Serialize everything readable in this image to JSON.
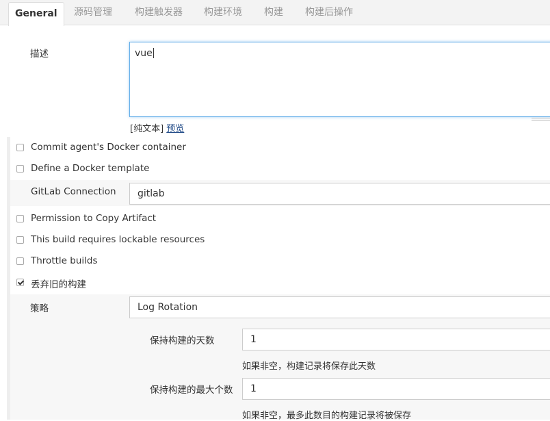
{
  "tabs": [
    {
      "label": "General",
      "active": true
    },
    {
      "label": "源码管理"
    },
    {
      "label": "构建触发器"
    },
    {
      "label": "构建环境"
    },
    {
      "label": "构建"
    },
    {
      "label": "构建后操作"
    }
  ],
  "description": {
    "label": "描述",
    "value": "vue",
    "hint_prefix": "[纯文本]",
    "preview_link": "预览"
  },
  "options": {
    "commit_docker": {
      "label": "Commit agent's Docker container",
      "checked": false
    },
    "docker_template": {
      "label": "Define a Docker template",
      "checked": false
    },
    "permission_copy": {
      "label": "Permission to Copy Artifact",
      "checked": false
    },
    "lockable": {
      "label": "This build requires lockable resources",
      "checked": false
    },
    "throttle": {
      "label": "Throttle builds",
      "checked": false
    },
    "discard_old": {
      "label": "丢弃旧的构建",
      "checked": true
    }
  },
  "gitlab": {
    "label": "GitLab Connection",
    "value": "gitlab"
  },
  "strategy": {
    "label": "策略",
    "value": "Log Rotation",
    "days": {
      "label": "保持构建的天数",
      "value": "1",
      "hint": "如果非空，构建记录将保存此天数"
    },
    "max_builds": {
      "label": "保持构建的最大个数",
      "value": "1",
      "hint": "如果非空，最多此数目的构建记录将被保存"
    }
  }
}
